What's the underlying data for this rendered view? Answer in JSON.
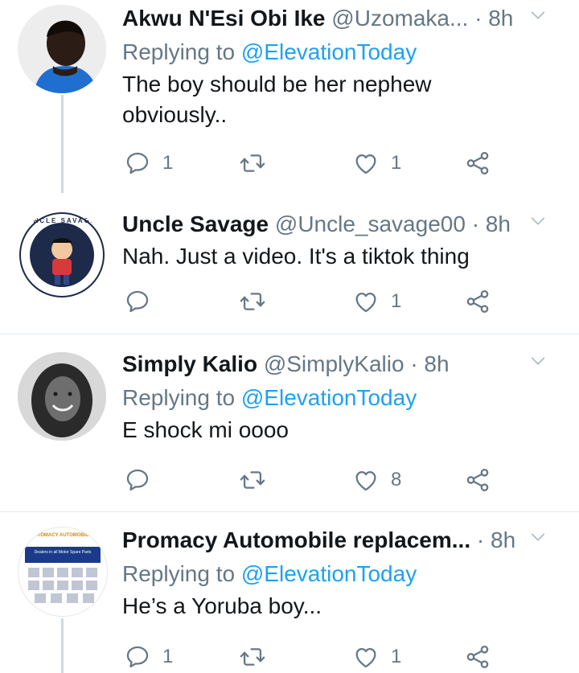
{
  "tweets": [
    {
      "name": "Akwu N'Esi Obi Ike",
      "handle": "@Uzomaka...",
      "time": "· 8h",
      "reply_prefix": "Replying to ",
      "reply_to": "@ElevationToday",
      "text": "The boy should be her nephew obviously..",
      "replies": "1",
      "retweets": "",
      "likes": "1"
    },
    {
      "name": "Uncle Savage",
      "handle": "@Uncle_savage00",
      "time": "· 8h",
      "text": "Nah.  Just a video.  It's a tiktok thing",
      "replies": "",
      "retweets": "",
      "likes": "1",
      "avatar_text": "UNCLE SAVAGE"
    },
    {
      "name": "Simply Kalio",
      "handle": "@SimplyKalio",
      "time": "· 8h",
      "reply_prefix": "Replying to ",
      "reply_to": "@ElevationToday",
      "text": "E shock mi oooo",
      "replies": "",
      "retweets": "",
      "likes": "8"
    },
    {
      "name": "Promacy Automobile replacem...",
      "handle": "",
      "time": "· 8h",
      "reply_prefix": "Replying to ",
      "reply_to": "@ElevationToday",
      "text": "He’s a Yoruba boy...",
      "replies": "1",
      "retweets": "",
      "likes": "1",
      "avatar_text": "PROMACY AUTOMOBILE",
      "avatar_subtext": "Dealers in all Motor Spare Parts"
    }
  ],
  "icons": {
    "reply": "reply-icon",
    "retweet": "retweet-icon",
    "like": "like-icon",
    "share": "share-icon",
    "more": "chevron-down-icon"
  },
  "colors": {
    "mention": "#1da1f2",
    "secondary_text": "#657786",
    "divider": "#e1e8ed",
    "thread_line": "#cfd9de"
  }
}
